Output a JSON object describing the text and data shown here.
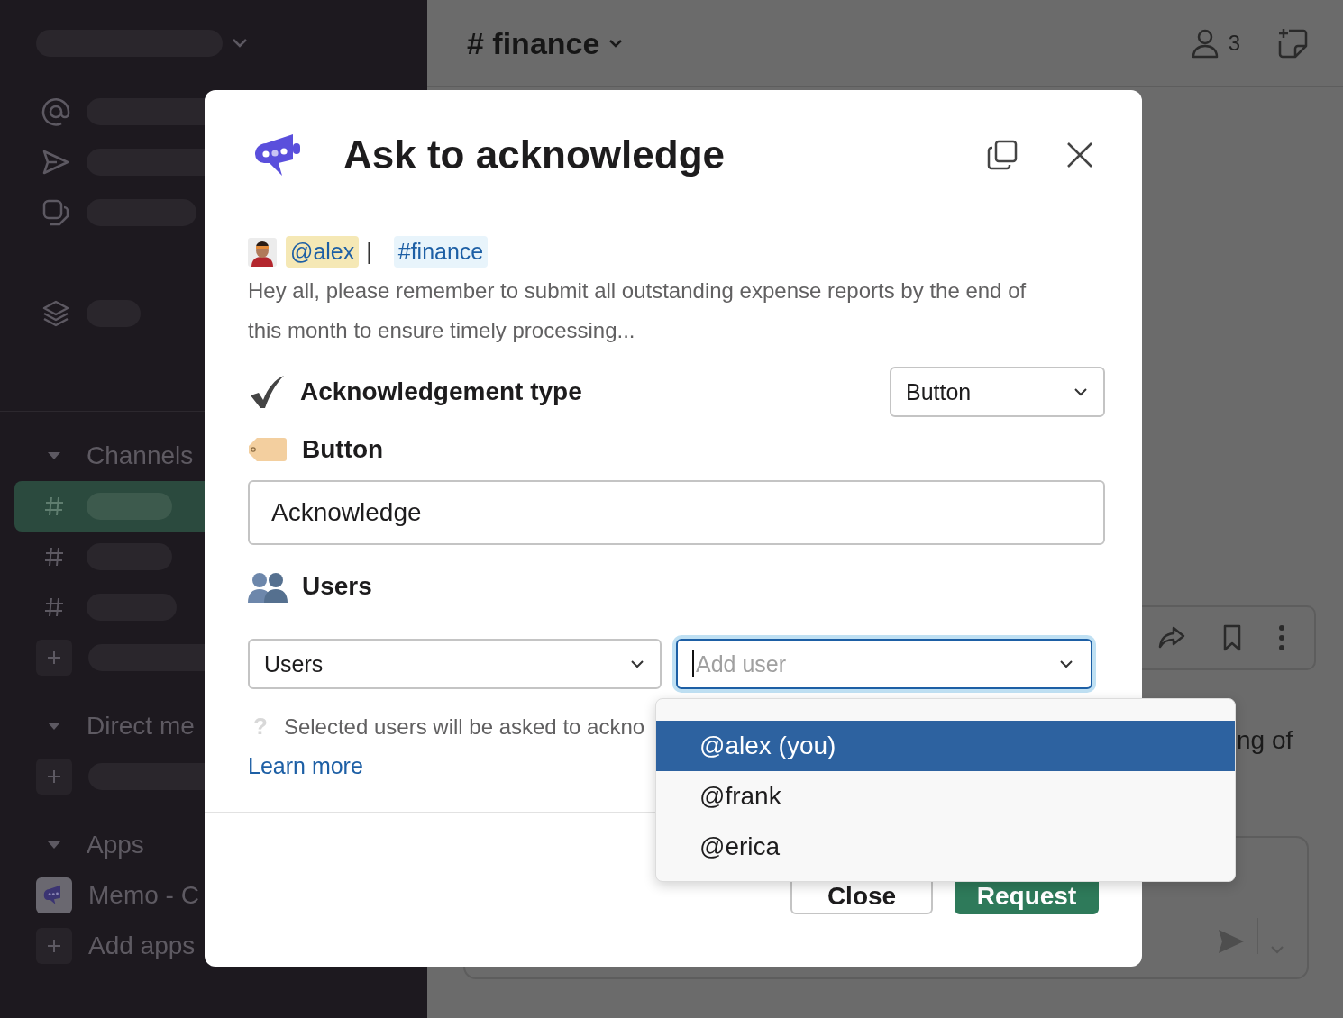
{
  "sidebar": {
    "sections": [
      {
        "title": "Channels",
        "expanded": true,
        "channels": [
          {
            "selected": true
          },
          {
            "selected": false
          },
          {
            "selected": false
          }
        ]
      },
      {
        "title": "Direct me",
        "expanded": true
      },
      {
        "title": "Apps",
        "expanded": true
      }
    ],
    "app_name": "Memo - C",
    "add_apps": "Add apps"
  },
  "header": {
    "channel": "# finance",
    "member_count": "3"
  },
  "background": {
    "message_fragment": "ng of"
  },
  "modal": {
    "title": "Ask to acknowledge",
    "mention": {
      "user": "@alex",
      "separator": "|",
      "channel": "#finance"
    },
    "message": "Hey all, please remember to submit all outstanding expense reports by the end of this month to ensure timely processing...",
    "ack_type": {
      "label": "Acknowledgement type",
      "value": "Button"
    },
    "button": {
      "label": "Button",
      "value": "Acknowledge"
    },
    "users": {
      "label": "Users",
      "mode": "Users",
      "placeholder": "Add user",
      "focused": true,
      "hint_icon": "?",
      "hint": "Selected users will be asked to ackno",
      "link": "Learn more"
    },
    "buttons": [
      {
        "label": "Close",
        "kind": "secondary"
      },
      {
        "label": "Request",
        "kind": "primary"
      }
    ],
    "options": [
      {
        "label": "@alex (you)",
        "selected": true
      },
      {
        "label": "@frank",
        "selected": false
      },
      {
        "label": "@erica",
        "selected": false
      }
    ]
  }
}
